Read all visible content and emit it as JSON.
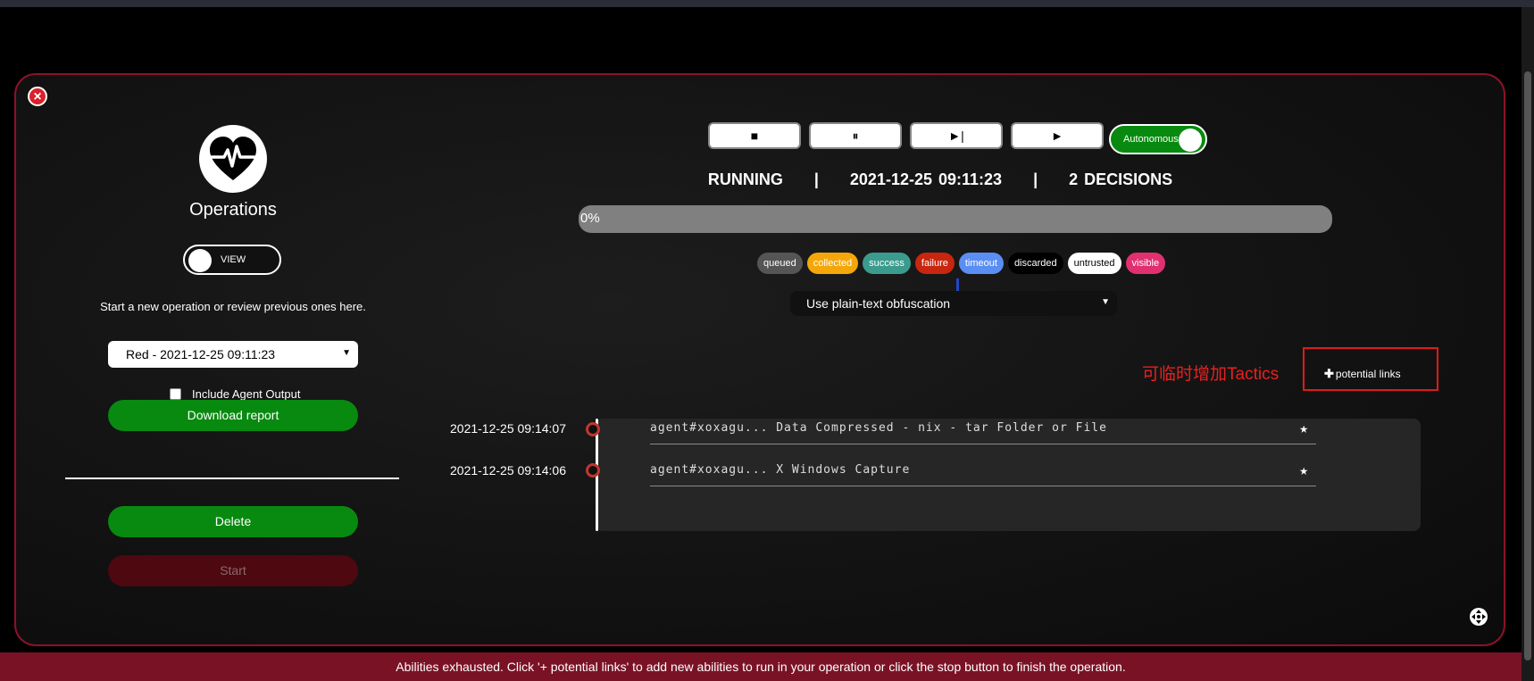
{
  "left": {
    "title": "Operations",
    "view_toggle_label": "VIEW",
    "intro": "Start a new operation or review previous ones here.",
    "operation_select_value": "Red - 2021-12-25 09:11:23",
    "include_agent_output_label": "Include Agent Output",
    "download_report_label": "Download report",
    "delete_label": "Delete",
    "start_label": "Start"
  },
  "controls": {
    "stop_icon": "■",
    "pause_icon": "⏸",
    "step_icon": "►|",
    "play_icon": "►",
    "autonomous_label": "Autonomous"
  },
  "status": {
    "state": "RUNNING",
    "timestamp": "2021-12-25 09:11:23",
    "decisions": "2 DECISIONS",
    "sep": "|"
  },
  "progress": {
    "label": "0%",
    "value": 0
  },
  "legend": [
    {
      "label": "queued",
      "bg": "#555555",
      "fg": "#ffffff"
    },
    {
      "label": "collected",
      "bg": "#f5a70a",
      "fg": "#ffffff"
    },
    {
      "label": "success",
      "bg": "#3b9b8e",
      "fg": "#ffffff"
    },
    {
      "label": "failure",
      "bg": "#c9260f",
      "fg": "#ffffff"
    },
    {
      "label": "timeout",
      "bg": "#5b8ef2",
      "fg": "#ffffff"
    },
    {
      "label": "discarded",
      "bg": "#000000",
      "fg": "#ffffff"
    },
    {
      "label": "untrusted",
      "bg": "#ffffff",
      "fg": "#000000"
    },
    {
      "label": "visible",
      "bg": "#e0306f",
      "fg": "#ffffff"
    }
  ],
  "obfuscation_select_value": "Use plain-text obfuscation",
  "annotation": "可临时增加Tactics",
  "potential_links_label": "potential links",
  "timeline": [
    {
      "timestamp": "2021-12-25 09:14:07",
      "text": "agent#xoxagu... Data Compressed - nix - tar Folder or File"
    },
    {
      "timestamp": "2021-12-25 09:14:06",
      "text": "agent#xoxagu... X Windows Capture"
    }
  ],
  "footer": "Abilities exhausted. Click '+ potential links' to add new abilities to run in your operation or click the stop button to finish the operation.",
  "colors": {
    "accent_green": "#078a0f",
    "panel_border": "#8b1228",
    "footer_bg": "#7a1226"
  }
}
